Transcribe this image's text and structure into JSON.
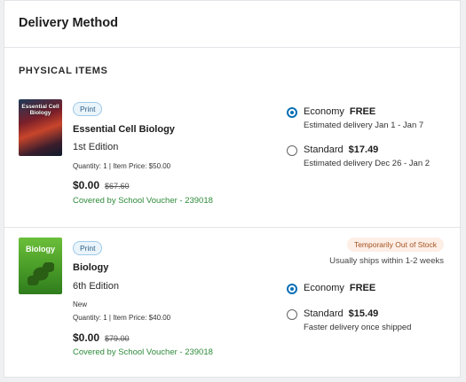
{
  "header": {
    "title": "Delivery Method"
  },
  "section": {
    "title": "PHYSICAL ITEMS"
  },
  "items": [
    {
      "cover_text": "Essential Cell Biology",
      "badge": "Print",
      "title": "Essential Cell Biology",
      "edition": "1st Edition",
      "qty": "Quantity: 1  |  Item Price: $50.00",
      "price": "$0.00",
      "original_price": "$67.60",
      "voucher": "Covered by School Voucher - 239018",
      "options": [
        {
          "label": "Economy",
          "price": "FREE",
          "sub": "Estimated delivery Jan 1 - Jan 7",
          "selected": true
        },
        {
          "label": "Standard",
          "price": "$17.49",
          "sub": "Estimated delivery Dec 26 - Jan 2",
          "selected": false
        }
      ]
    },
    {
      "cover_text": "Biology",
      "badge": "Print",
      "title": "Biology",
      "edition": "6th Edition",
      "condition": "New",
      "qty": "Quantity: 1  |  Item Price: $40.00",
      "price": "$0.00",
      "original_price": "$79.00",
      "voucher": "Covered by School Voucher - 239018",
      "stock_badge": "Temporarily Out of Stock",
      "ships_note": "Usually ships within 1-2 weeks",
      "options": [
        {
          "label": "Economy",
          "price": "FREE",
          "selected": true
        },
        {
          "label": "Standard",
          "price": "$15.49",
          "sub": "Faster delivery once shipped",
          "selected": false
        }
      ]
    }
  ],
  "colors": {
    "accent": "#0a6fb5",
    "voucher": "#2e8b3a",
    "stock_warning": "#a4521f"
  }
}
